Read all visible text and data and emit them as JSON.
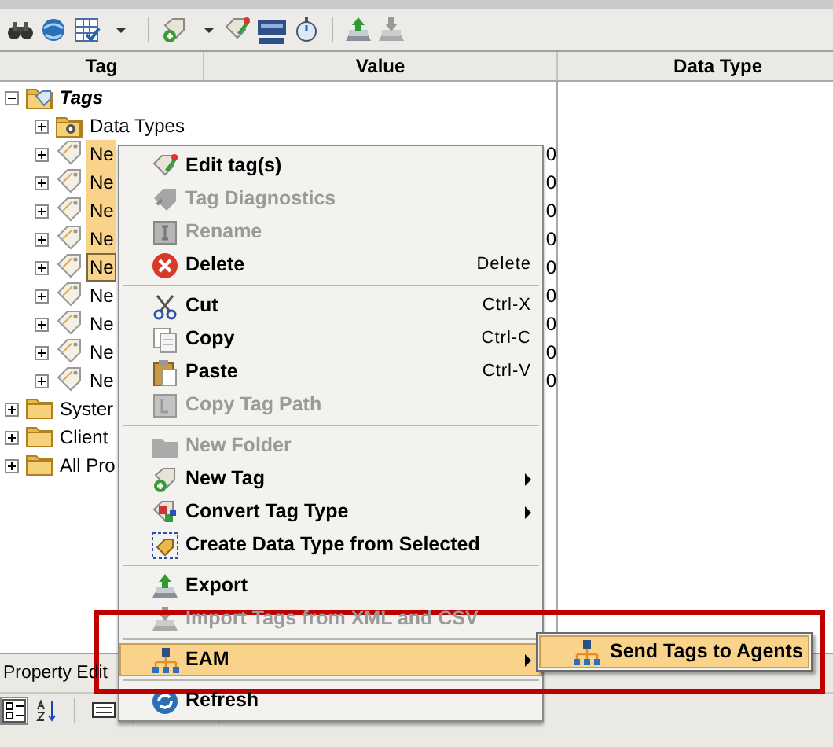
{
  "columns": [
    "Tag",
    "Value",
    "Data Type"
  ],
  "tree": [
    {
      "label": "Tags",
      "kind": "root",
      "expanded": true,
      "selected": false,
      "children": [
        {
          "label": "Data Types",
          "kind": "datatypes",
          "selected": false
        },
        {
          "label": "Ne",
          "kind": "tag",
          "selected": true,
          "focused": false,
          "value": "0"
        },
        {
          "label": "Ne",
          "kind": "tag",
          "selected": true,
          "focused": false,
          "value": "0"
        },
        {
          "label": "Ne",
          "kind": "tag",
          "selected": true,
          "focused": false,
          "value": "0"
        },
        {
          "label": "Ne",
          "kind": "tag",
          "selected": true,
          "focused": false,
          "value": "0"
        },
        {
          "label": "Ne",
          "kind": "tag",
          "selected": true,
          "focused": true,
          "value": "0"
        },
        {
          "label": "Ne",
          "kind": "tag",
          "selected": false,
          "focused": false,
          "value": "0"
        },
        {
          "label": "Ne",
          "kind": "tag",
          "selected": false,
          "focused": false,
          "value": "0"
        },
        {
          "label": "Ne",
          "kind": "tag",
          "selected": false,
          "focused": false,
          "value": "0"
        },
        {
          "label": "Ne",
          "kind": "tag",
          "selected": false,
          "focused": false,
          "value": "0"
        }
      ]
    },
    {
      "label": "Syster",
      "kind": "folder",
      "expanded": false,
      "selected": false
    },
    {
      "label": "Client",
      "kind": "folder",
      "expanded": false,
      "selected": false
    },
    {
      "label": "All Pro",
      "kind": "folder",
      "expanded": false,
      "selected": false
    }
  ],
  "context_menu": [
    {
      "kind": "item",
      "label": "Edit tag(s)",
      "disabled": false,
      "selected": false
    },
    {
      "kind": "item",
      "label": "Tag Diagnostics",
      "disabled": true,
      "selected": false
    },
    {
      "kind": "item",
      "label": "Rename",
      "disabled": true,
      "selected": false
    },
    {
      "kind": "item",
      "label": "Delete",
      "shortcut": "Delete",
      "disabled": false,
      "selected": false
    },
    {
      "kind": "separator"
    },
    {
      "kind": "item",
      "label": "Cut",
      "shortcut": "Ctrl-X",
      "disabled": false,
      "selected": false
    },
    {
      "kind": "item",
      "label": "Copy",
      "shortcut": "Ctrl-C",
      "disabled": false,
      "selected": false
    },
    {
      "kind": "item",
      "label": "Paste",
      "shortcut": "Ctrl-V",
      "disabled": false,
      "selected": false
    },
    {
      "kind": "item",
      "label": "Copy Tag Path",
      "disabled": true,
      "selected": false
    },
    {
      "kind": "separator"
    },
    {
      "kind": "item",
      "label": "New Folder",
      "disabled": true,
      "selected": false
    },
    {
      "kind": "item",
      "label": "New Tag",
      "submenu": true,
      "disabled": false,
      "selected": false
    },
    {
      "kind": "item",
      "label": "Convert Tag Type",
      "submenu": true,
      "disabled": false,
      "selected": false
    },
    {
      "kind": "item",
      "label": "Create Data Type from Selected",
      "disabled": false,
      "selected": false
    },
    {
      "kind": "separator"
    },
    {
      "kind": "item",
      "label": "Export",
      "disabled": false,
      "selected": false
    },
    {
      "kind": "item",
      "label": "Import Tags from XML and CSV",
      "disabled": true,
      "selected": false
    },
    {
      "kind": "separator"
    },
    {
      "kind": "item",
      "label": "EAM",
      "submenu": true,
      "disabled": false,
      "selected": true
    },
    {
      "kind": "separator"
    },
    {
      "kind": "item",
      "label": "Refresh",
      "disabled": false,
      "selected": false
    }
  ],
  "submenu": [
    {
      "label": "Send Tags to Agents",
      "selected": true
    }
  ],
  "property_editor": {
    "title": "Property Edit"
  }
}
